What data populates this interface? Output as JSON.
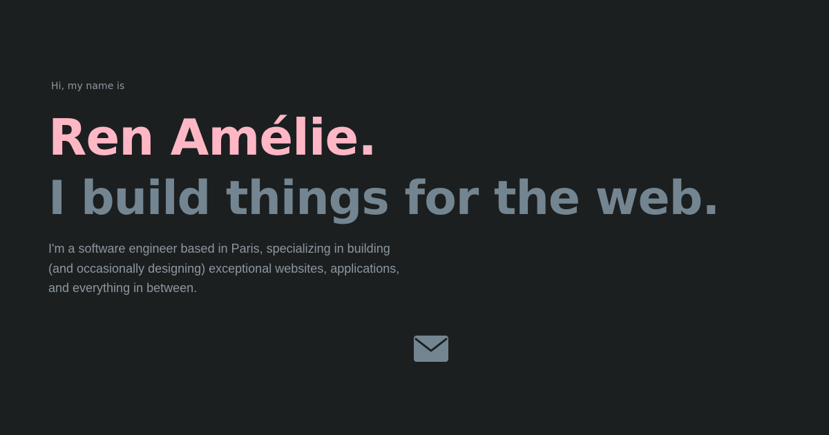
{
  "hero": {
    "greeting": "Hi, my name is",
    "name": "Ren Amélie.",
    "tagline": "I build things for the web.",
    "bio": "I'm a software engineer based in Paris, specializing in building (and occasionally designing) exceptional websites, applications, and everything in between."
  },
  "contact": {
    "icon": "envelope-icon"
  },
  "colors": {
    "background": "#1c1f20",
    "name": "#ffb7c5",
    "tagline": "#738590",
    "body_text": "#8b979f",
    "icon": "#738590"
  }
}
